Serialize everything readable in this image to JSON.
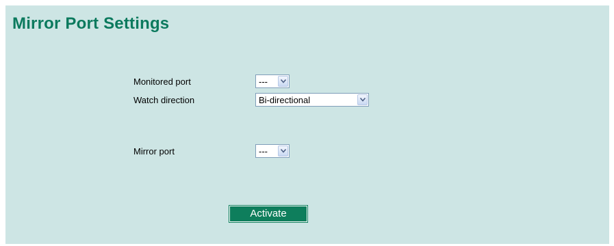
{
  "page": {
    "title": "Mirror Port Settings"
  },
  "form": {
    "monitored_port": {
      "label": "Monitored port",
      "value": "---"
    },
    "watch_direction": {
      "label": "Watch direction",
      "value": "Bi-directional"
    },
    "mirror_port": {
      "label": "Mirror port",
      "value": "---"
    }
  },
  "actions": {
    "activate_label": "Activate"
  },
  "icons": {
    "dropdown": "chevron-down-icon"
  },
  "colors": {
    "panel_background": "#cde5e4",
    "title": "#0c7a5e",
    "button": "#0e7e5c"
  }
}
